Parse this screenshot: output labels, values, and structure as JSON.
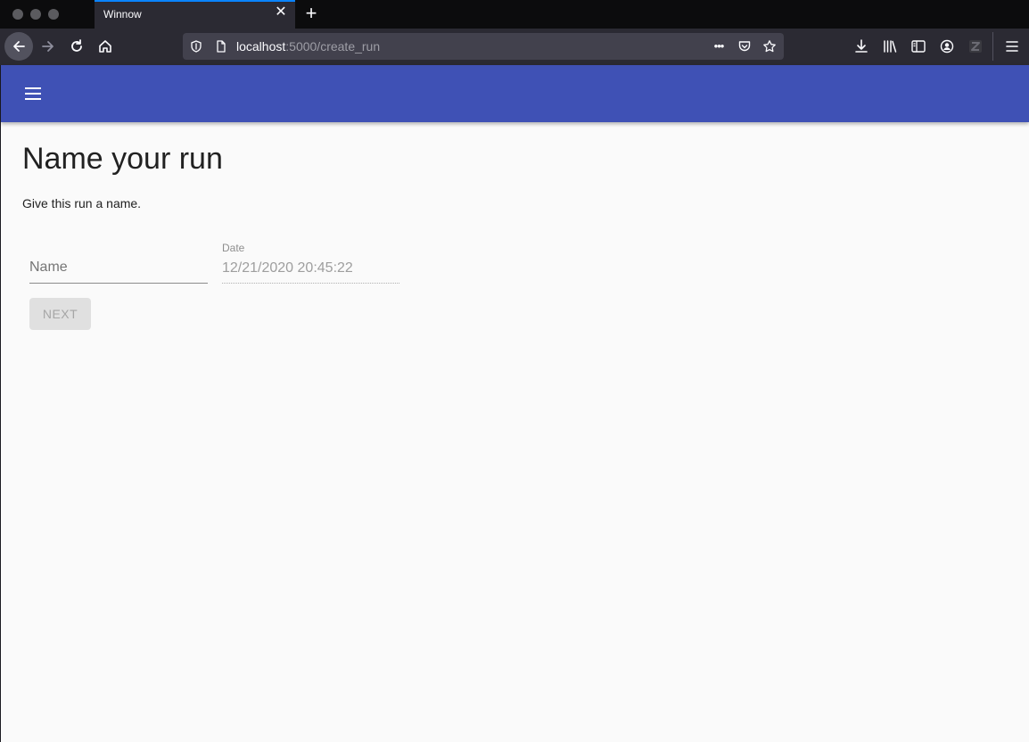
{
  "browser": {
    "tab_title": "Winnow",
    "tab_close": "✕",
    "new_tab": "+",
    "url_host": "localhost",
    "url_rest": ":5000/create_run",
    "page_actions": "•••"
  },
  "page": {
    "heading": "Name your run",
    "subtitle": "Give this run a name.",
    "name_placeholder": "Name",
    "name_value": "",
    "date_label": "Date",
    "date_value": "12/21/2020 20:45:22",
    "next_label": "NEXT"
  },
  "colors": {
    "appbar": "#3f51b5",
    "accent": "#0a84ff"
  }
}
